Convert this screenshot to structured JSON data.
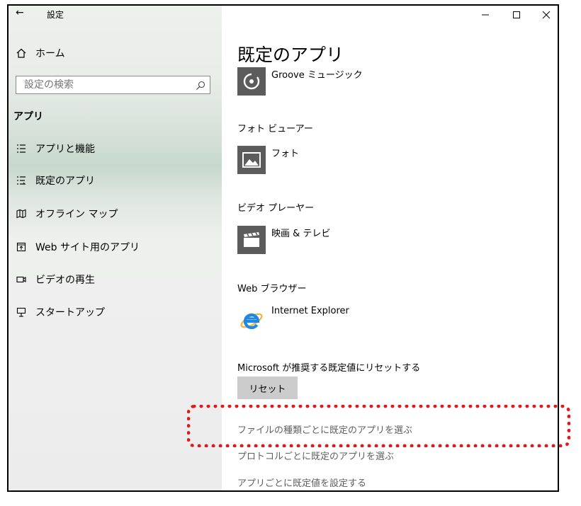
{
  "window": {
    "title": "設定"
  },
  "sidebar": {
    "home_label": "ホーム",
    "search_placeholder": "設定の検索",
    "section_label": "アプリ",
    "items": [
      {
        "label": "アプリと機能",
        "icon": "list-icon"
      },
      {
        "label": "既定のアプリ",
        "icon": "default-apps-icon"
      },
      {
        "label": "オフライン マップ",
        "icon": "map-icon"
      },
      {
        "label": "Web サイト用のアプリ",
        "icon": "website-app-icon"
      },
      {
        "label": "ビデオの再生",
        "icon": "video-icon"
      },
      {
        "label": "スタートアップ",
        "icon": "startup-icon"
      }
    ]
  },
  "main": {
    "title": "既定のアプリ",
    "music_app": "Groove ミュージック",
    "photo_category": "フォト ビューアー",
    "photo_app": "フォト",
    "video_category": "ビデオ プレーヤー",
    "video_app": "映画 & テレビ",
    "browser_category": "Web ブラウザー",
    "browser_app": "Internet Explorer",
    "reset_label": "Microsoft が推奨する既定値にリセットする",
    "reset_button": "リセット",
    "links": [
      "ファイルの種類ごとに既定のアプリを選ぶ",
      "プロトコルごとに既定のアプリを選ぶ",
      "アプリごとに既定値を設定する"
    ]
  },
  "colors": {
    "highlight": "#e01a1a",
    "tile": "#5c5c5c",
    "accent": "#1e88e5"
  }
}
